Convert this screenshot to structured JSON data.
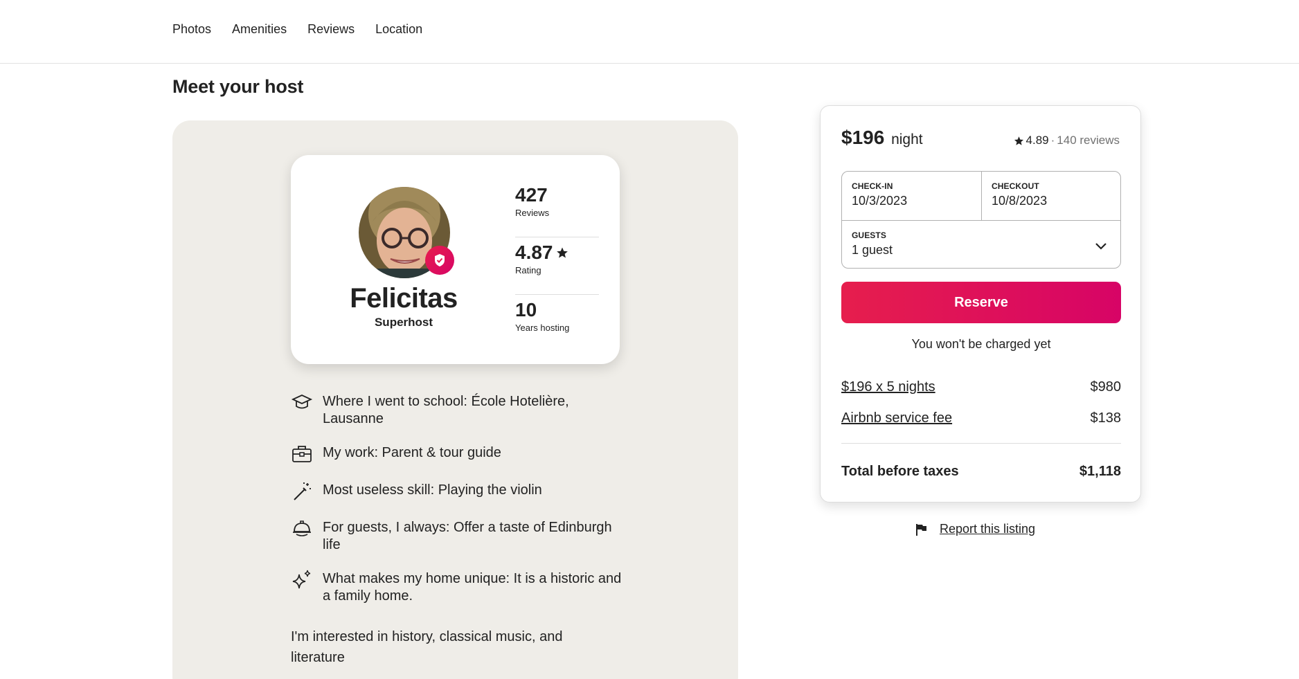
{
  "nav": {
    "links": [
      "Photos",
      "Amenities",
      "Reviews",
      "Location"
    ]
  },
  "section_title": "Meet your host",
  "host": {
    "name": "Felicitas",
    "role": "Superhost",
    "stats": [
      {
        "value": "427",
        "label": "Reviews"
      },
      {
        "value": "4.87",
        "label": "Rating"
      },
      {
        "value": "10",
        "label": "Years hosting"
      }
    ],
    "facts": [
      {
        "icon": "graduation-cap-icon",
        "text": "Where I went to school: École Hotelière, Lausanne"
      },
      {
        "icon": "briefcase-icon",
        "text": "My work: Parent & tour guide"
      },
      {
        "icon": "magic-wand-icon",
        "text": "Most useless skill: Playing the violin"
      },
      {
        "icon": "cloche-icon",
        "text": "For guests, I always: Offer a taste of Edinburgh life"
      },
      {
        "icon": "sparkles-icon",
        "text": "What makes my home unique: It is a historic and a family home."
      }
    ],
    "about": "I'm interested in history, classical music, and literature"
  },
  "booking": {
    "price": "$196",
    "price_unit": "night",
    "rating": "4.89",
    "reviews": "140 reviews",
    "checkin_label": "CHECK-IN",
    "checkin_value": "10/3/2023",
    "checkout_label": "CHECKOUT",
    "checkout_value": "10/8/2023",
    "guests_label": "GUESTS",
    "guests_value": "1 guest",
    "reserve_label": "Reserve",
    "note": "You won't be charged yet",
    "lines": [
      {
        "label": "$196 x 5 nights",
        "amount": "$980"
      },
      {
        "label": "Airbnb service fee",
        "amount": "$138"
      }
    ],
    "total_label": "Total before taxes",
    "total_amount": "$1,118"
  },
  "report_label": "Report this listing",
  "colors": {
    "accent": "#e61e4d",
    "accent_end": "#d70466",
    "panel_bg": "#efede8"
  }
}
